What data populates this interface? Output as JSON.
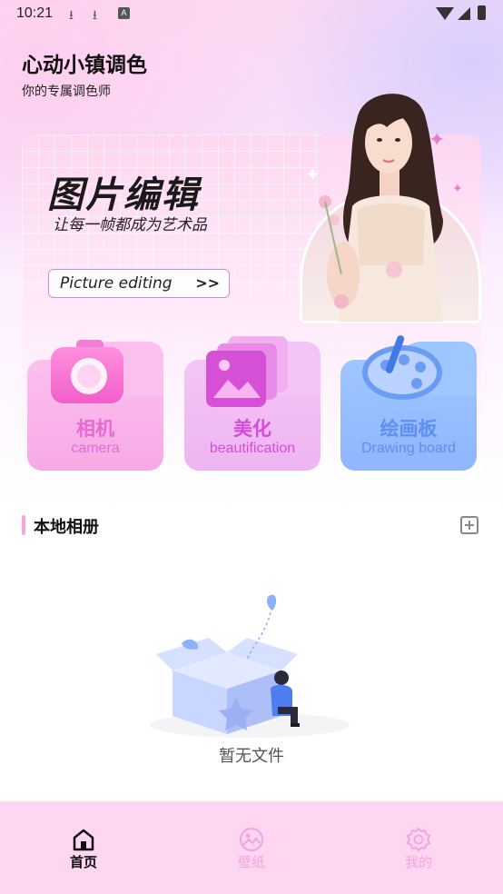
{
  "status_bar": {
    "time": "10:21",
    "icons": [
      "download-icon",
      "download-icon",
      "a-badge-icon",
      "wifi-icon",
      "signal-icon",
      "battery-icon"
    ]
  },
  "header": {
    "title": "心动小镇调色",
    "subtitle": "你的专属调色师"
  },
  "banner": {
    "title": "图片编辑",
    "slogan": "让每一帧都成为艺术品",
    "button_label": "Picture editing",
    "button_icon": ">>"
  },
  "features": [
    {
      "label": "相机",
      "sub": "camera",
      "icon": "camera-icon"
    },
    {
      "label": "美化",
      "sub": "beautification",
      "icon": "photo-gallery-icon"
    },
    {
      "label": "绘画板",
      "sub": "Drawing board",
      "icon": "palette-icon"
    }
  ],
  "album": {
    "title": "本地相册",
    "empty_text": "暂无文件"
  },
  "bottom_nav": [
    {
      "label": "首页",
      "icon": "home-icon",
      "active": true
    },
    {
      "label": "壁纸",
      "icon": "wallpaper-icon",
      "active": false
    },
    {
      "label": "我的",
      "icon": "settings-icon",
      "active": false
    }
  ],
  "colors": {
    "accent_pink": "#f5a6dc",
    "nav_background": "#ffd6f1",
    "board_blue": "#8fb6ff"
  }
}
